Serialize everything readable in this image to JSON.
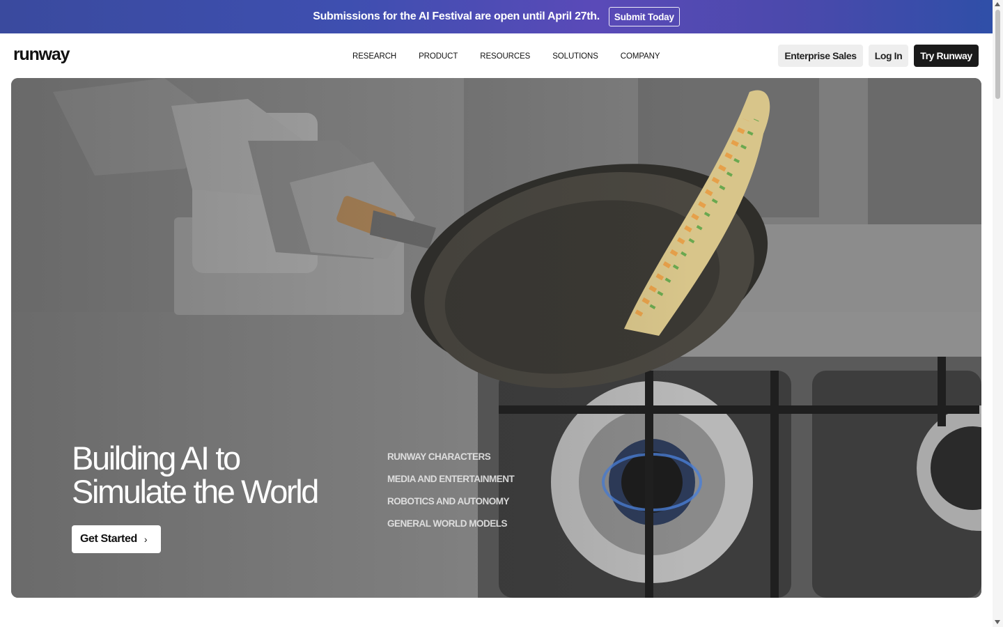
{
  "banner": {
    "text": "Submissions for the AI Festival are open until April 27th.",
    "button_label": "Submit Today"
  },
  "header": {
    "logo": "runway",
    "nav": [
      "RESEARCH",
      "PRODUCT",
      "RESOURCES",
      "SOLUTIONS",
      "COMPANY"
    ],
    "enterprise_label": "Enterprise Sales",
    "login_label": "Log In",
    "try_label": "Try Runway"
  },
  "hero": {
    "title_line1": "Building AI to",
    "title_line2": "Simulate the World",
    "cta_label": "Get Started",
    "links": [
      "RUNWAY CHARACTERS",
      "MEDIA AND ENTERTAINMENT",
      "ROBOTICS AND AUTONOMY",
      "GENERAL WORLD MODELS"
    ]
  },
  "colors": {
    "banner_gradient_start": "#3a4a9e",
    "banner_gradient_mid": "#5a4ab8",
    "primary_button": "#1a1a1a",
    "secondary_button": "#eeeeee"
  },
  "icons": {
    "cta_chevron": "chevron-right-icon",
    "scroll_up": "scroll-up-arrow-icon",
    "scroll_down": "scroll-down-arrow-icon"
  }
}
